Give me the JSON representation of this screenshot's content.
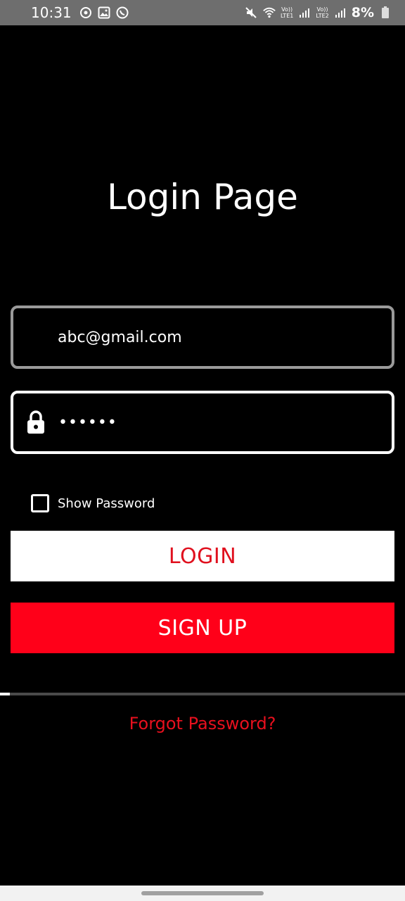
{
  "status_bar": {
    "time": "10:31",
    "left_icons": [
      "sync-icon",
      "image-icon",
      "whatsapp-icon"
    ],
    "right_icons": [
      "mute-icon",
      "wifi-icon",
      "signal-icon",
      "signal-icon"
    ],
    "sim1_label_top": "Vo))",
    "sim1_label_bottom": "LTE1",
    "sim2_label_top": "Vo))",
    "sim2_label_bottom": "LTE2",
    "battery": "8%"
  },
  "title": "Login Page",
  "email_field": {
    "value": "abc@gmail.com"
  },
  "password_field": {
    "icon": "lock-icon",
    "masked_value": "••••••"
  },
  "show_password": {
    "label": "Show Password",
    "checked": false
  },
  "buttons": {
    "login": "LOGIN",
    "signup": "SIGN UP"
  },
  "progress": {
    "fraction": 0.025
  },
  "forgot_password": "Forgot Password?",
  "colors": {
    "background": "#000000",
    "accent_red": "#ff0019",
    "login_text": "#e0101e",
    "status_bar": "#6e6e6e"
  }
}
